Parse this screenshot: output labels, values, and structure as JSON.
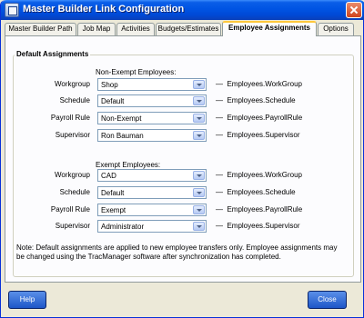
{
  "window": {
    "title": "Master Builder Link Configuration"
  },
  "tabs": [
    {
      "label": "Master Builder Path"
    },
    {
      "label": "Job Map"
    },
    {
      "label": "Activities"
    },
    {
      "label": "Budgets/Estimates"
    },
    {
      "label": "Employee Assignments"
    },
    {
      "label": "Options"
    }
  ],
  "group_title": "Default Assignments",
  "non_exempt": {
    "heading": "Non-Exempt Employees:",
    "rows": [
      {
        "label": "Workgroup",
        "value": "Shop",
        "mapping": "Employees.WorkGroup"
      },
      {
        "label": "Schedule",
        "value": "Default",
        "mapping": "Employees.Schedule"
      },
      {
        "label": "Payroll Rule",
        "value": "Non-Exempt",
        "mapping": "Employees.PayrollRule"
      },
      {
        "label": "Supervisor",
        "value": "Ron Bauman",
        "mapping": "Employees.Supervisor"
      }
    ]
  },
  "exempt": {
    "heading": "Exempt Employees:",
    "rows": [
      {
        "label": "Workgroup",
        "value": "CAD",
        "mapping": "Employees.WorkGroup"
      },
      {
        "label": "Schedule",
        "value": "Default",
        "mapping": "Employees.Schedule"
      },
      {
        "label": "Payroll Rule",
        "value": "Exempt",
        "mapping": "Employees.PayrollRule"
      },
      {
        "label": "Supervisor",
        "value": "Administrator",
        "mapping": "Employees.Supervisor"
      }
    ]
  },
  "note": "Note: Default assignments are applied to new employee transfers only. Employee assignments may be changed using the TracManager software after synchronization has completed.",
  "buttons": {
    "help": "Help",
    "close": "Close"
  },
  "colors": {
    "titlebar": "#0054e3",
    "active_tab_accent": "#ffc83c",
    "button": "#1d56c8"
  }
}
